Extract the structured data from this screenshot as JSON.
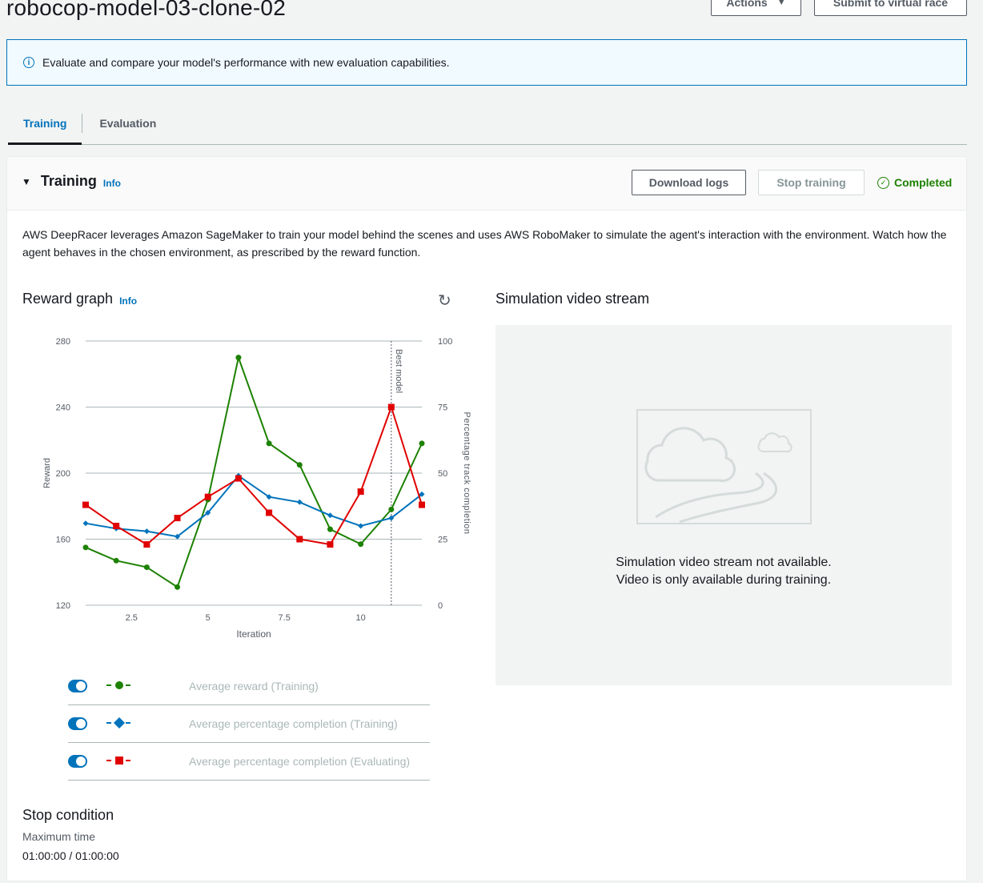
{
  "header": {
    "title": "robocop-model-03-clone-02",
    "actions_label": "Actions",
    "submit_label": "Submit to virtual race"
  },
  "banner": {
    "text": "Evaluate and compare your model's performance with new evaluation capabilities."
  },
  "tabs": [
    {
      "label": "Training",
      "active": true
    },
    {
      "label": "Evaluation",
      "active": false
    }
  ],
  "training": {
    "title": "Training",
    "info": "Info",
    "download_logs": "Download logs",
    "stop_training": "Stop training",
    "status": "Completed",
    "description": "AWS DeepRacer leverages Amazon SageMaker to train your model behind the scenes and uses AWS RoboMaker to simulate the agent's interaction with the environment. Watch how the agent behaves in the chosen environment, as prescribed by the reward function."
  },
  "reward_graph": {
    "title": "Reward graph",
    "info": "Info"
  },
  "chart_data": {
    "type": "line",
    "xlabel": "Iteration",
    "ylabel": "Reward",
    "y2label": "Percentage track completion",
    "xlim": [
      1,
      12
    ],
    "ylim": [
      120,
      280
    ],
    "y2lim": [
      0,
      100
    ],
    "x_ticks": [
      "2.5",
      "5",
      "7.5",
      "10"
    ],
    "y_ticks": [
      "120",
      "160",
      "200",
      "240",
      "280"
    ],
    "y2_ticks": [
      "0",
      "25",
      "50",
      "75",
      "100"
    ],
    "annotation": {
      "label": "Best model",
      "x": 11
    },
    "grid": true,
    "x": [
      1,
      2,
      3,
      4,
      5,
      6,
      7,
      8,
      9,
      10,
      11,
      12
    ],
    "series": [
      {
        "name": "Average reward (Training)",
        "axis": "left",
        "color": "#1d8102",
        "marker": "circle",
        "values": [
          155,
          147,
          143,
          131,
          184,
          270,
          218,
          205,
          166,
          157,
          178,
          218
        ]
      },
      {
        "name": "Average percentage completion (Training)",
        "axis": "right",
        "color": "#0073bb",
        "marker": "diamond",
        "values": [
          31,
          29,
          28,
          26,
          35,
          49,
          41,
          39,
          34,
          30,
          33,
          42
        ]
      },
      {
        "name": "Average percentage completion (Evaluating)",
        "axis": "right",
        "color": "#e00000",
        "marker": "square",
        "values": [
          38,
          30,
          23,
          33,
          41,
          48,
          35,
          25,
          23,
          43,
          75,
          38
        ]
      }
    ]
  },
  "legend": {
    "items": [
      {
        "label": "Average reward (Training)"
      },
      {
        "label": "Average percentage completion (Training)"
      },
      {
        "label": "Average percentage completion (Evaluating)"
      }
    ]
  },
  "video": {
    "title": "Simulation video stream",
    "line1": "Simulation video stream not available.",
    "line2": "Video is only available during training."
  },
  "stop_condition": {
    "title": "Stop condition",
    "label": "Maximum time",
    "value": "01:00:00 / 01:00:00"
  },
  "icons": {
    "info": "info-circle-icon",
    "caret": "caret-down-icon",
    "refresh": "refresh-icon",
    "status": "check-circle-icon"
  }
}
